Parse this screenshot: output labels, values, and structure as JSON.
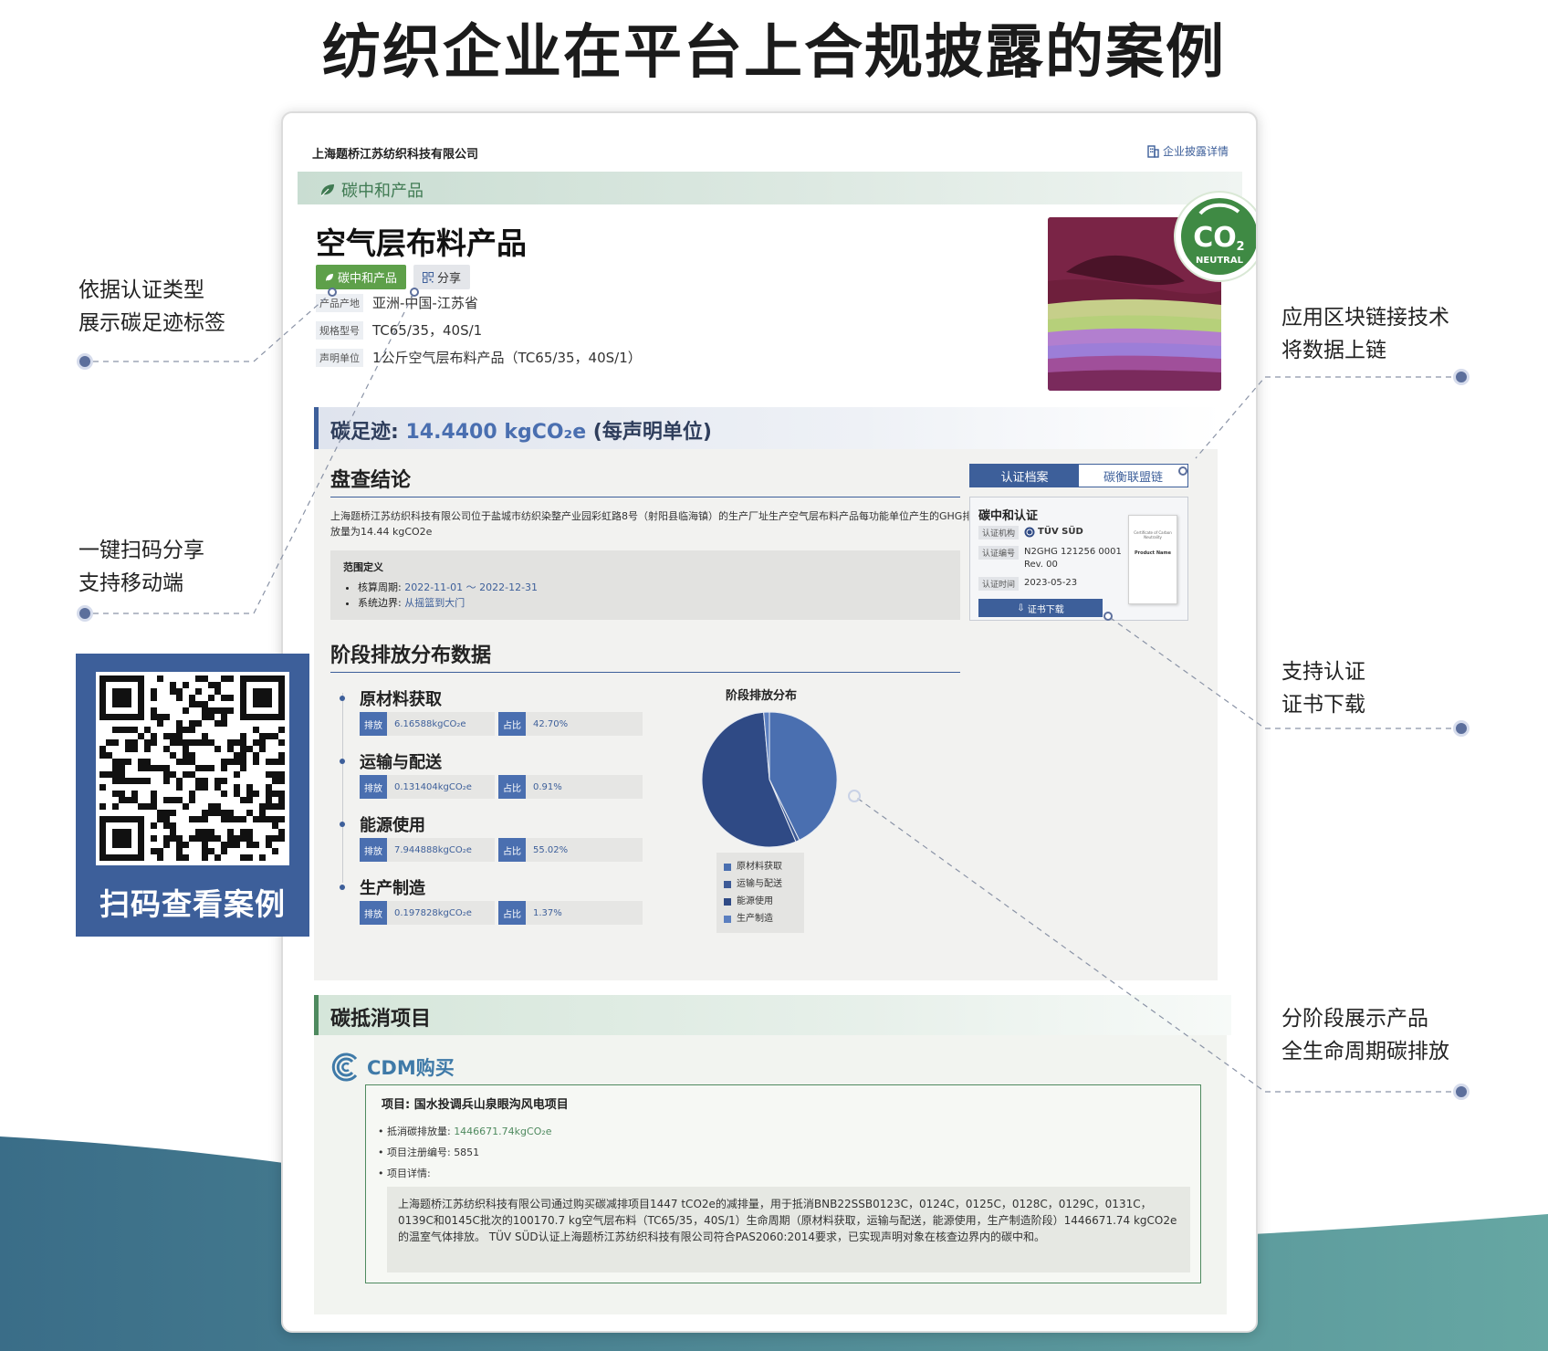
{
  "main_title": "纺织企业在平台上合规披露的案例",
  "annotations": {
    "label_tag": [
      "依据认证类型",
      "展示碳足迹标签"
    ],
    "qr_share": [
      "一键扫码分享",
      "支持移动端"
    ],
    "blockchain": [
      "应用区块链接技术",
      "将数据上链"
    ],
    "cert_download": [
      "支持认证",
      "证书下载"
    ],
    "lifecycle": [
      "分阶段展示产品",
      "全生命周期碳排放"
    ]
  },
  "qr_card": {
    "label": "扫码查看案例"
  },
  "page": {
    "company": "上海题桥江苏纺织科技有限公司",
    "disclosure_link": "企业披露详情",
    "band_label": "碳中和产品",
    "product_title": "空气层布料产品",
    "tags": {
      "carbon_neutral": "碳中和产品",
      "share": "分享"
    },
    "attributes": [
      {
        "key": "产品产地",
        "value": "亚洲-中国-江苏省"
      },
      {
        "key": "规格型号",
        "value": "TC65/35，40S/1"
      },
      {
        "key": "声明单位",
        "value": "1公斤空气层布料产品（TC65/35，40S/1）"
      }
    ],
    "co2_badge": {
      "main": "CO",
      "sub": "2",
      "text": "NEUTRAL"
    },
    "footprint": {
      "label": "碳足迹: ",
      "value": "14.4400 kgCO₂e",
      "unit": " (每声明单位)"
    },
    "conclusion": {
      "heading": "盘查结论",
      "text": "上海题桥江苏纺织科技有限公司位于盐城市纺织染整产业园彩虹路8号（射阳县临海镇）的生产厂址生产空气层布料产品每功能单位产生的GHG排放量为14.44 kgCO2e",
      "scope_title": "范围定义",
      "period_label": "核算周期: ",
      "period_value": "2022-11-01 ～ 2022-12-31",
      "boundary_label": "系统边界: ",
      "boundary_value": "从摇篮到大门"
    },
    "stages": {
      "heading": "阶段排放分布数据",
      "emission_label": "排放",
      "share_label": "占比",
      "items": [
        {
          "name": "原材料获取",
          "emission": "6.16588kgCO₂e",
          "share": "42.70%"
        },
        {
          "name": "运输与配送",
          "emission": "0.131404kgCO₂e",
          "share": "0.91%"
        },
        {
          "name": "能源使用",
          "emission": "7.944888kgCO₂e",
          "share": "55.02%"
        },
        {
          "name": "生产制造",
          "emission": "0.197828kgCO₂e",
          "share": "1.37%"
        }
      ]
    },
    "cert": {
      "tab_active": "认证档案",
      "tab_inactive": "碳衡联盟链",
      "title": "碳中和认证",
      "rows": [
        {
          "key": "认证机构",
          "value": "TÜV SÜD"
        },
        {
          "key": "认证编号",
          "value": "N2GHG 121256 0001 Rev. 00"
        },
        {
          "key": "认证时间",
          "value": "2023-05-23"
        }
      ],
      "download": "证书下载",
      "thumb_title": "Certificate of Carbon Neutrality",
      "thumb_product": "Product Name"
    },
    "offset": {
      "heading": "碳抵消项目",
      "type": "CDM购买",
      "project_label": "项目: ",
      "project_name": "国水投调兵山泉眼沟风电项目",
      "amount_label": "• 抵消碳排放量: ",
      "amount_value": "1446671.74kgCO₂e",
      "reg_label": "• 项目注册编号: ",
      "reg_value": "5851",
      "detail_label": "• 项目详情:",
      "detail_text": "上海题桥江苏纺织科技有限公司通过购买碳减排项目1447 tCO2e的减排量，用于抵消BNB22SSB0123C，0124C，0125C，0128C，0129C，0131C，0139C和0145C批次的100170.7 kg空气层布料（TC65/35，40S/1）生命周期（原材料获取，运输与配送，能源使用，生产制造阶段）1446671.74 kgCO2e的温室气体排放。 TÜV SÜD认证上海题桥江苏纺织科技有限公司符合PAS2060:2014要求，已实现声明对象在核查边界内的碳中和。"
    }
  },
  "chart_data": {
    "type": "pie",
    "title": "阶段排放分布",
    "categories": [
      "原材料获取",
      "运输与配送",
      "能源使用",
      "生产制造"
    ],
    "values": [
      42.7,
      0.91,
      55.02,
      1.37
    ],
    "colors": [
      "#4a6fb0",
      "#3d5a96",
      "#2f4a85",
      "#5b7fc0"
    ],
    "legend": "bottom"
  },
  "colors": {
    "accent": "#3d5f9a",
    "green": "#5ea04a",
    "teal": "#5b9aa0"
  }
}
